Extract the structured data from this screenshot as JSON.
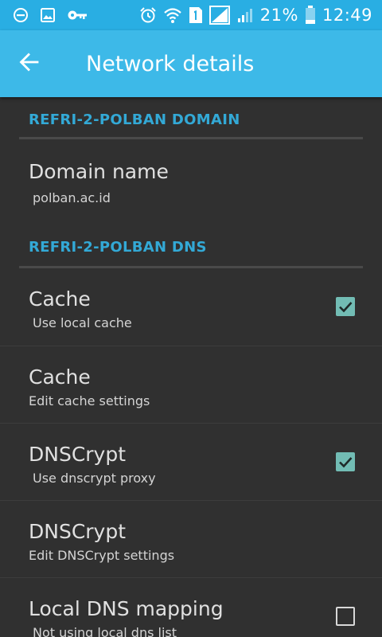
{
  "status_bar": {
    "icons_left": [
      "minus-circle-icon",
      "image-icon",
      "key-icon"
    ],
    "icons_right": [
      "alarm-icon",
      "wifi-icon",
      "sim-1-icon",
      "signal-icon",
      "signal-weak-icon",
      "battery-icon"
    ],
    "battery": "21%",
    "time": "12:49"
  },
  "app_bar": {
    "title": "Network details",
    "back_icon": "arrow-back-icon"
  },
  "sections": [
    {
      "header": "REFRI-2-POLBAN DOMAIN",
      "items": [
        {
          "title": "Domain name",
          "summary": "polban.ac.id"
        }
      ]
    },
    {
      "header": "REFRI-2-POLBAN DNS",
      "items": [
        {
          "title": "Cache",
          "summary": "Use local cache",
          "checked": true
        },
        {
          "title": "Cache",
          "summary": "Edit cache settings"
        },
        {
          "title": "DNSCrypt",
          "summary": "Use dnscrypt proxy",
          "checked": true
        },
        {
          "title": "DNSCrypt",
          "summary": "Edit DNSCrypt settings"
        },
        {
          "title": "Local DNS mapping",
          "summary": "Not using local dns list",
          "checked": false
        }
      ]
    }
  ],
  "colors": {
    "status_bar": "#29aee3",
    "app_bar": "#3db9e8",
    "background": "#303030",
    "accent": "#33a9d6",
    "checkbox_checked": "#72bcb4"
  }
}
